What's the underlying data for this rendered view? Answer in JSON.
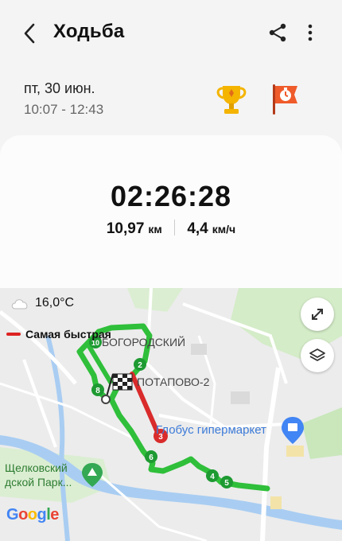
{
  "header": {
    "title": "Ходьба",
    "back_icon": "back-arrow-icon",
    "share_icon": "share-icon",
    "more_icon": "more-vertical-icon"
  },
  "session": {
    "date": "пт, 30 июн.",
    "time_range": "10:07 - 12:43"
  },
  "badges": {
    "trophy_icon": "trophy-icon",
    "flag_icon": "stopwatch-flag-icon"
  },
  "summary": {
    "duration": "02:26:28",
    "distance_value": "10,97",
    "distance_unit": "км",
    "speed_value": "4,4",
    "speed_unit": "км/ч"
  },
  "map": {
    "temperature": "16,0°C",
    "legend_fastest": "Самая быстрая",
    "labels": {
      "bogorodsky": "БОГОРОДСКИЙ",
      "potapovo": "ПОТАПОВО-2",
      "globus": "Глобус гипермаркет",
      "shchelkovsky": "Щелковский",
      "park": "дской Парк..."
    },
    "markers": [
      "2",
      "3",
      "4",
      "5",
      "6",
      "8",
      "10"
    ],
    "attribution": "Google",
    "colors": {
      "route": "#2fbf3a",
      "fastest": "#d92b2b",
      "marker": "#1e9a32"
    }
  }
}
